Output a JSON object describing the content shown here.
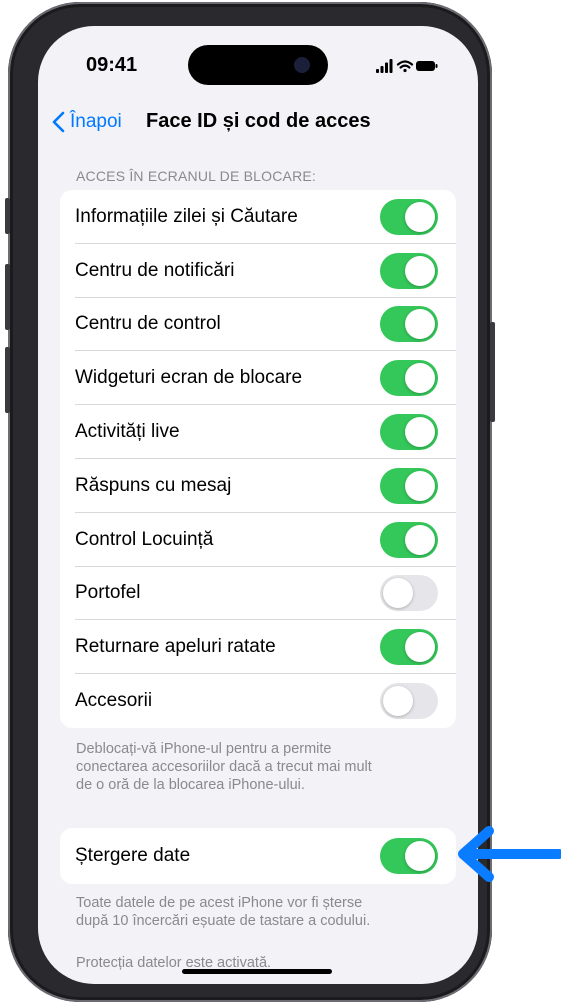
{
  "status_bar": {
    "time": "09:41"
  },
  "nav": {
    "back_label": "Înapoi",
    "title": "Face ID și cod de acces"
  },
  "lock_screen_section": {
    "header": "ACCES ÎN ECRANUL DE BLOCARE:",
    "items": [
      {
        "label": "Informațiile zilei și Căutare",
        "enabled": true
      },
      {
        "label": "Centru de notificări",
        "enabled": true
      },
      {
        "label": "Centru de control",
        "enabled": true
      },
      {
        "label": "Widgeturi ecran de blocare",
        "enabled": true
      },
      {
        "label": "Activități live",
        "enabled": true
      },
      {
        "label": "Răspuns cu mesaj",
        "enabled": true
      },
      {
        "label": "Control Locuință",
        "enabled": true
      },
      {
        "label": "Portofel",
        "enabled": false
      },
      {
        "label": "Returnare apeluri ratate",
        "enabled": true
      },
      {
        "label": "Accesorii",
        "enabled": false
      }
    ],
    "footer_lines": [
      "Deblocați-vă iPhone-ul pentru a permite",
      "conectarea accesoriilor dacă a trecut mai mult",
      "de o oră de la blocarea iPhone-ului."
    ]
  },
  "erase_section": {
    "label": "Ștergere date",
    "enabled": true,
    "footer_lines": [
      "Toate datele de pe acest iPhone vor fi șterse",
      "după 10 încercări eșuate de tastare a codului."
    ],
    "status_text": "Protecția datelor este activată."
  },
  "colors": {
    "accent": "#007aff",
    "toggle_on": "#34c759",
    "toggle_off": "#e6e6ea",
    "arrow": "#0a7cff"
  }
}
